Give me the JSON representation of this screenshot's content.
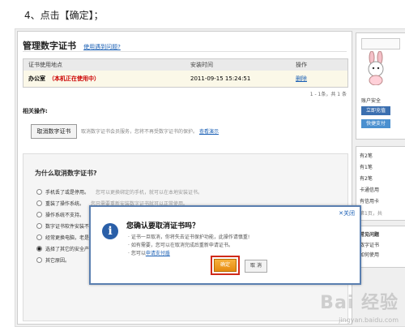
{
  "step_heading": "4、点击【确定】；",
  "page": {
    "title": "管理数字证书",
    "help_link": "使用遇到问题?",
    "table": {
      "headers": [
        "证书使用地点",
        "安装时间",
        "操作"
      ],
      "row": {
        "location": "办公室",
        "status": "（本机正在使用中）",
        "time": "2011-09-15 15:24:51",
        "action": "删除"
      }
    },
    "pager": "1 - 1条，共 1 条",
    "related_label": "相关操作:",
    "cancel_button": "取消数字证书",
    "cancel_desc": "取消数字证书会员服务，您将不再受数字证书的保护。",
    "cancel_demo_link": "查看演示"
  },
  "why": {
    "title": "为什么取消数字证书?",
    "options": [
      {
        "label": "手机丢了或是停用。",
        "desc": "您可以更换绑定的手机，就可以在本地安装证书。"
      },
      {
        "label": "重装了操作系统。",
        "desc": "您只需要重新安装数字证书就可以正常使用。"
      },
      {
        "label": "操作系统不支持。",
        "desc": ""
      },
      {
        "label": "数字证书软件安装不上。",
        "desc": ""
      },
      {
        "label": "经常更换电脑，老是要安装证书不方便。",
        "desc": ""
      },
      {
        "label": "选择了其它的安全产品",
        "desc": ""
      },
      {
        "label": "其它原因。",
        "desc": ""
      }
    ],
    "selected_index": 5
  },
  "sidebar": {
    "account_text": "账户安全",
    "recharge_btn": "立即充值",
    "fast_pay": "快捷支付",
    "items": [
      "有2笔",
      "有1笔",
      "有2笔",
      "卡通信用",
      "有信用卡"
    ],
    "pager": "第1页，共",
    "faq_title": "常见问题",
    "faq_items": [
      "数字证书",
      "如何使用"
    ]
  },
  "modal": {
    "close_label": "关闭",
    "title": "您确认要取消证书吗？",
    "lines": [
      "· 证书一旦取消，你将失去证书保护功能，此操作请慎重!",
      "· 如有需要，您可以在取消完成后重新申请证书。",
      "· 您可以"
    ],
    "apply_link": "申请支付盾",
    "confirm_label": "确定",
    "cancel_label": "取 消"
  },
  "watermark": {
    "main": "Bai 经验",
    "sub": "jingyan.baidu.com"
  },
  "colors": {
    "accent": "#1a5fb4",
    "highlight": "#d02a1a",
    "confirm": "#f0a030"
  }
}
